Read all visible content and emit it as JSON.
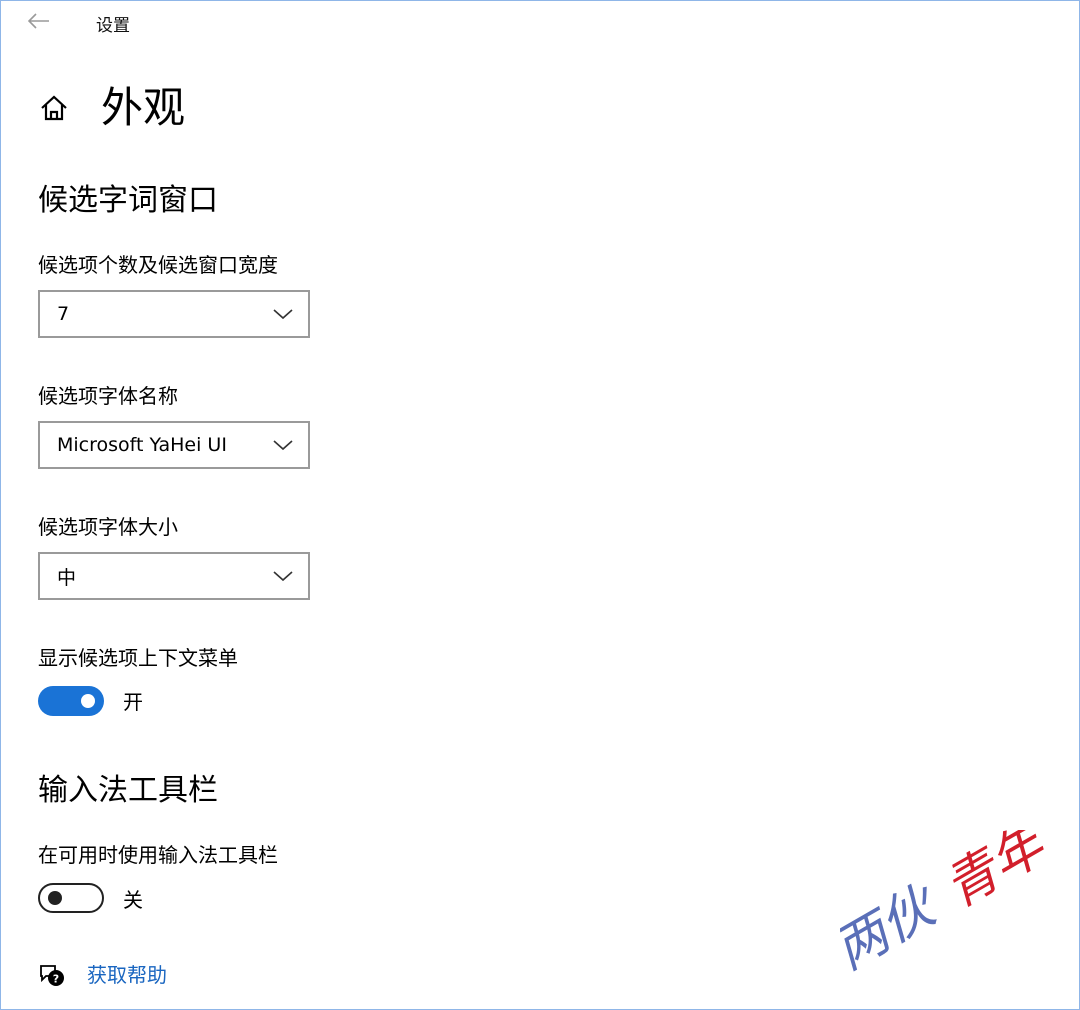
{
  "window": {
    "title": "设置"
  },
  "page": {
    "title": "外观"
  },
  "sections": {
    "candidate_window": {
      "heading": "候选字词窗口",
      "count_width": {
        "label": "候选项个数及候选窗口宽度",
        "value": "7"
      },
      "font_name": {
        "label": "候选项字体名称",
        "value": "Microsoft YaHei UI"
      },
      "font_size": {
        "label": "候选项字体大小",
        "value": "中"
      },
      "context_menu": {
        "label": "显示候选项上下文菜单",
        "state_text": "开",
        "on": true
      }
    },
    "ime_toolbar": {
      "heading": "输入法工具栏",
      "use_toolbar": {
        "label": "在可用时使用输入法工具栏",
        "state_text": "关",
        "on": false
      }
    }
  },
  "help": {
    "link": "获取帮助"
  },
  "watermark": {
    "text": "两伙青年"
  },
  "colors": {
    "accent": "#1a73d6",
    "link": "#1a66c0",
    "frame": "#8fb6e8",
    "watermark_red": "#d21f2b",
    "watermark_blue": "#5a6fb8"
  }
}
